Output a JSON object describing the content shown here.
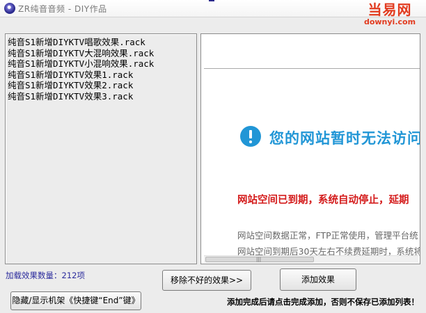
{
  "window": {
    "title": "ZR纯音音频 - DIY作品"
  },
  "watermark": {
    "brand": "当易网",
    "domain": "downyi.com"
  },
  "effects_list": {
    "items": [
      "纯音S1新增DIYKTV唱歌效果.rack",
      "纯音S1新增DIYKTV大混响效果.rack",
      "纯音S1新增DIYKTV小混响效果.rack",
      "纯音S1新增DIYKTV效果1.rack",
      "纯音S1新增DIYKTV效果2.rack",
      "纯音S1新增DIYKTV效果3.rack"
    ]
  },
  "browser": {
    "notice_title": "您的网站暂时无法访问",
    "expired_text": "网站空间已到期，系统自动停止，延期",
    "line1": "网站空间数据正常，FTP正常使用，管理平台统",
    "line2": "网站空间到期后30天左右不续费延期时，系统将",
    "scroll_grip": "|||"
  },
  "footer": {
    "count_label": "加载效果数量：212项",
    "remove_button": "移除不好的效果>>",
    "add_button": "添加效果",
    "hide_button": "隐藏/显示机架《快捷键“End”键》",
    "hint_text": "添加完成后请点击完成添加，否则不保存已添加列表！"
  },
  "colors": {
    "accent_blue": "#2196d6",
    "alert_red": "#d41b1b",
    "count_blue": "#2a2a9c",
    "watermark_red": "#e23b1f"
  },
  "icons": {
    "app": "app-logo-icon",
    "notice": "info-exclamation-icon"
  }
}
